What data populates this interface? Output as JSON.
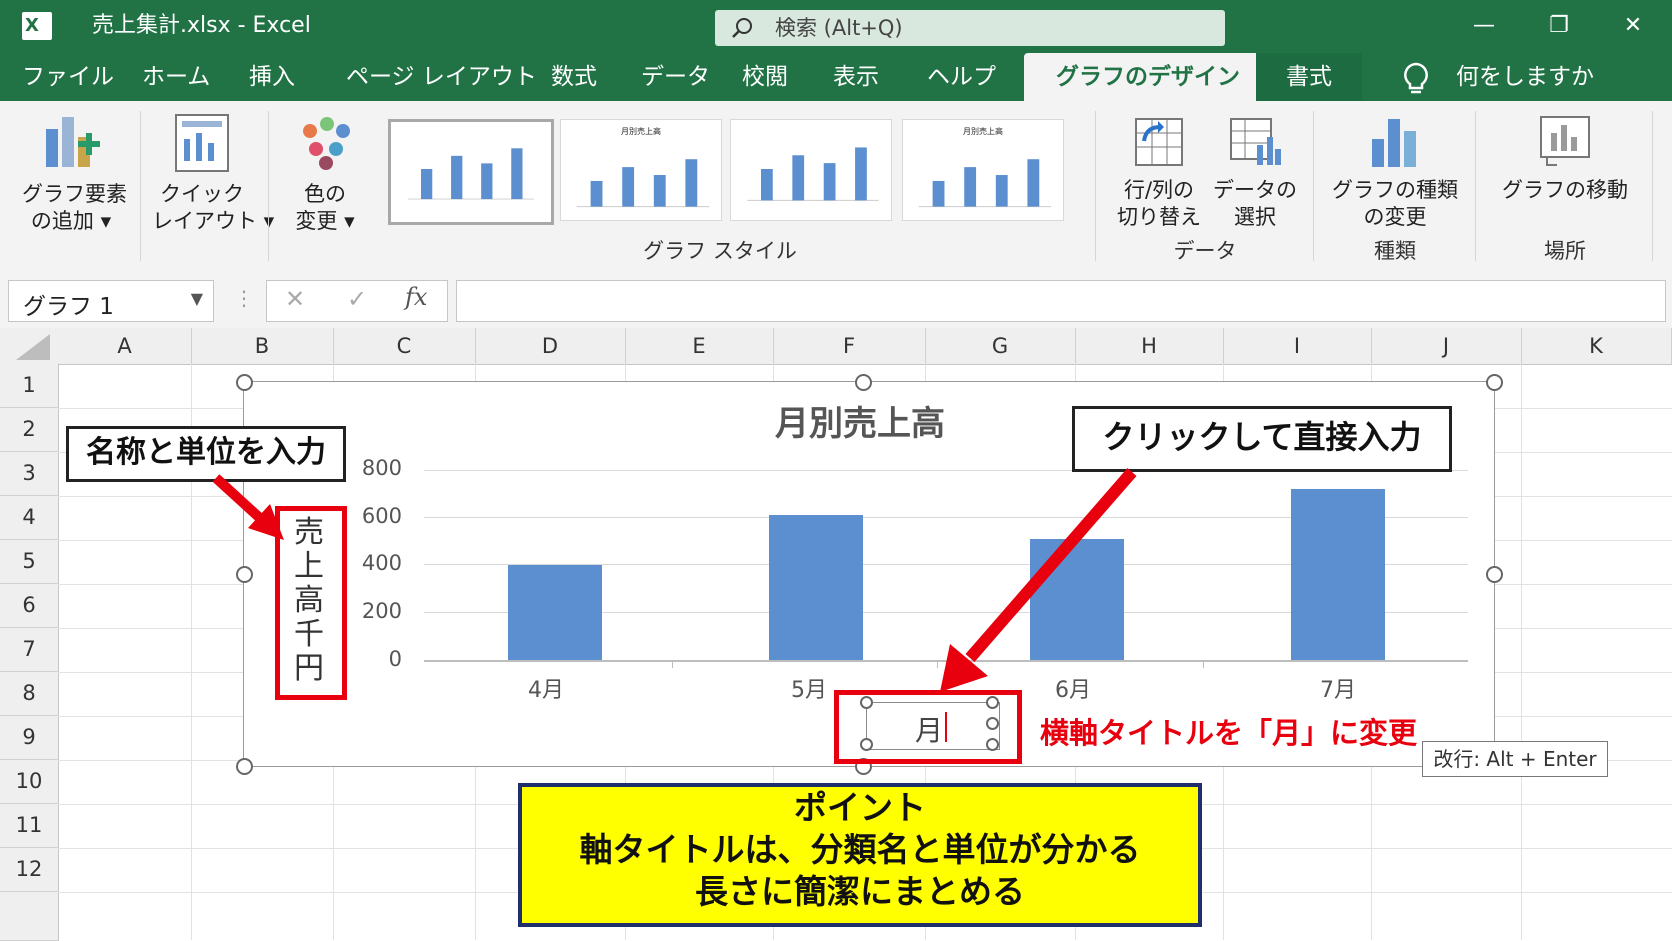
{
  "window": {
    "title": "売上集計.xlsx  -  Excel",
    "search_placeholder": "検索 (Alt+Q)",
    "controls": {
      "minimize": "—",
      "restore": "❐",
      "close": "✕"
    }
  },
  "tabs": [
    "ファイル",
    "ホーム",
    "挿入",
    "ページ レイアウト",
    "数式",
    "データ",
    "校閲",
    "表示",
    "ヘルプ",
    "グラフのデザイン",
    "書式"
  ],
  "tell_me": "何をしますか",
  "ribbon": {
    "add_element": {
      "line1": "グラフ要素",
      "line2": "の追加 ▾"
    },
    "quick_layout": {
      "line1": "クイック",
      "line2": "レイアウト ▾"
    },
    "change_colors": {
      "line1": "色の",
      "line2": "変更 ▾"
    },
    "thumb_title": "月別売上高",
    "styles_group": "グラフ スタイル",
    "switch_row_col": {
      "line1": "行/列の",
      "line2": "切り替え"
    },
    "select_data": {
      "line1": "データの",
      "line2": "選択"
    },
    "data_group": "データ",
    "change_type": {
      "line1": "グラフの種類",
      "line2": "の変更"
    },
    "type_group": "種類",
    "move_chart": "グラフの移動",
    "location_group": "場所"
  },
  "formula_bar": {
    "name_box": "グラフ 1",
    "cancel": "✕",
    "enter": "✓",
    "fx": "fx",
    "value": ""
  },
  "columns": [
    "A",
    "B",
    "C",
    "D",
    "E",
    "F",
    "G",
    "H",
    "I",
    "J",
    "K"
  ],
  "rows": [
    "1",
    "2",
    "3",
    "4",
    "5",
    "6",
    "7",
    "8",
    "9",
    "10",
    "11",
    "12"
  ],
  "chart_data": {
    "type": "bar",
    "title": "月別売上高",
    "categories": [
      "4月",
      "5月",
      "6月",
      "7月"
    ],
    "values": [
      400,
      610,
      510,
      720
    ],
    "ylim": [
      0,
      800
    ],
    "yticks": [
      "800",
      "600",
      "400",
      "200",
      "0"
    ],
    "ylabel": "売上高千円",
    "xlabel": "月",
    "colors": {
      "bar": "#5b8fd0"
    }
  },
  "annotations": {
    "left_callout": "名称と単位を入力",
    "right_callout": "クリックして直接入力",
    "red_note": "横軸タイトルを「月」に変更",
    "tooltip": "改行: Alt + Enter",
    "ylabel_chars": [
      "売",
      "上",
      "高",
      "千",
      "円"
    ],
    "point_title": "ポイント",
    "point_line1": "軸タイトルは、分類名と単位が分かる",
    "point_line2": "長さに簡潔にまとめる"
  }
}
